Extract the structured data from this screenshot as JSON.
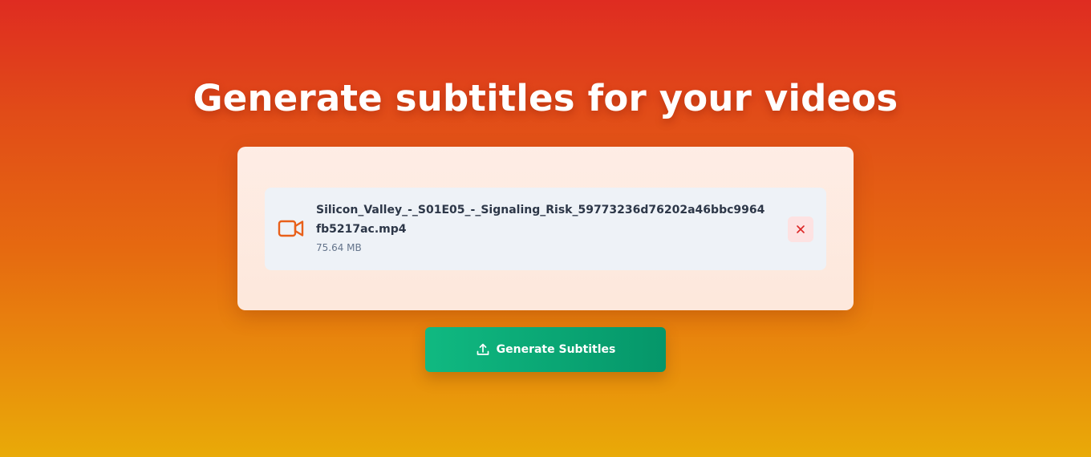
{
  "header": {
    "title": "Generate subtitles for your videos"
  },
  "file": {
    "name": "Silicon_Valley_-_S01E05_-_Signaling_Risk_59773236d76202a46bbc9964fb5217ac.mp4",
    "size": "75.64 MB",
    "icon": "video-camera-icon",
    "remove_icon": "close-icon"
  },
  "actions": {
    "generate_label": "Generate Subtitles",
    "generate_icon": "upload-icon"
  },
  "colors": {
    "accent_green": "#10b981",
    "video_icon": "#e8601a",
    "remove_red": "#dc2626"
  }
}
